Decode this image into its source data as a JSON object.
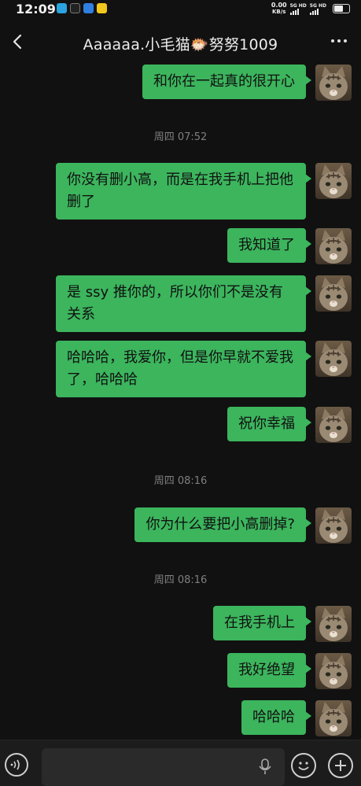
{
  "status_bar": {
    "time": "12:09",
    "net_speed": "0.00",
    "net_unit": "KB/s",
    "sim1": "5G HD",
    "sim2": "5G HD",
    "notification_icons": [
      "telegram-icon",
      "tiktok-icon",
      "app-icon",
      "yellow-app-icon"
    ]
  },
  "header": {
    "title": "Aaaaaa.小毛猫🐡努努1009"
  },
  "messages": [
    {
      "type": "text",
      "text": "和你在一起真的很开心"
    },
    {
      "type": "time",
      "text": "周四 07:52"
    },
    {
      "type": "text",
      "text": "你没有删小高，而是在我手机上把他删了"
    },
    {
      "type": "text",
      "text": "我知道了"
    },
    {
      "type": "text",
      "text": "是 ssy 推你的，所以你们不是没有关系"
    },
    {
      "type": "text",
      "text": "哈哈哈，我爱你，但是你早就不爱我了，哈哈哈"
    },
    {
      "type": "text",
      "text": "祝你幸福"
    },
    {
      "type": "time",
      "text": "周四 08:16"
    },
    {
      "type": "text",
      "text": "你为什么要把小高删掉?"
    },
    {
      "type": "time",
      "text": "周四 08:16"
    },
    {
      "type": "text",
      "text": "在我手机上"
    },
    {
      "type": "text",
      "text": "我好绝望"
    },
    {
      "type": "text",
      "text": "哈哈哈"
    }
  ],
  "input_bar": {
    "placeholder": ""
  },
  "colors": {
    "background": "#111111",
    "bubble": "#3cb55d",
    "timestamp": "#7f7f7f",
    "input_bar": "#1c1c1c"
  }
}
